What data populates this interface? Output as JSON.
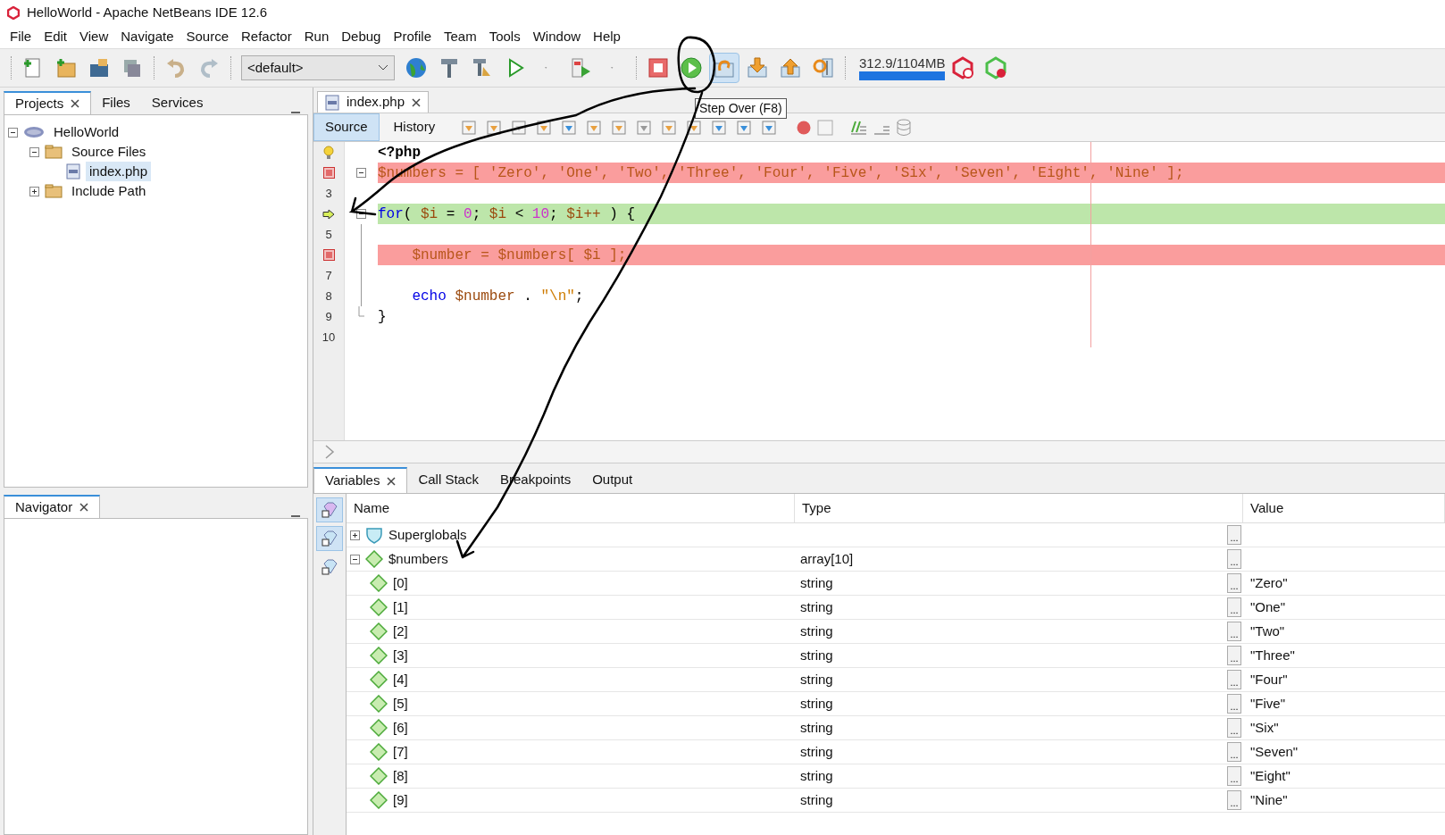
{
  "window": {
    "title": "HelloWorld - Apache NetBeans IDE 12.6"
  },
  "menu": [
    "File",
    "Edit",
    "View",
    "Navigate",
    "Source",
    "Refactor",
    "Run",
    "Debug",
    "Profile",
    "Team",
    "Tools",
    "Window",
    "Help"
  ],
  "toolbar": {
    "config": "<default>",
    "memory": "312.9/1104MB",
    "tooltip": "Step Over (F8)"
  },
  "left_tabs": [
    {
      "label": "Projects",
      "selected": true
    },
    {
      "label": "Files",
      "selected": false
    },
    {
      "label": "Services",
      "selected": false
    }
  ],
  "project_tree": [
    {
      "label": "HelloWorld",
      "kind": "project",
      "expanded": true,
      "selected": false,
      "children": [
        {
          "label": "Source Files",
          "kind": "folder",
          "expanded": true,
          "selected": false,
          "children": [
            {
              "label": "index.php",
              "kind": "file",
              "selected": true
            }
          ]
        },
        {
          "label": "Include Path",
          "kind": "folder",
          "expanded": false,
          "selected": false
        }
      ]
    }
  ],
  "navigator": {
    "title": "Navigator"
  },
  "editor_tabs": [
    {
      "label": "index.php",
      "selected": true
    }
  ],
  "view_tabs": [
    {
      "label": "Source",
      "selected": true
    },
    {
      "label": "History",
      "selected": false
    }
  ],
  "code_lines": [
    {
      "kind": "hint",
      "fold_start": false,
      "in_fold": false,
      "fold_end": false,
      "tokens": [
        {
          "text": "<?php",
          "kind": "tag"
        }
      ]
    },
    {
      "kind": "breakpoint",
      "fold_start": true,
      "in_fold": false,
      "fold_end": false,
      "tokens": [
        {
          "text": "$numbers = [ 'Zero', 'One', 'Two', 'Three', 'Four', 'Five', 'Six', 'Seven', 'Eight', 'Nine' ];",
          "kind": "plain"
        }
      ]
    },
    {
      "kind": "line",
      "number": "3",
      "fold_start": false,
      "in_fold": false,
      "fold_end": false
    },
    {
      "kind": "current",
      "fold_start": true,
      "in_fold": false,
      "fold_end": false,
      "tokens": [
        {
          "text": "for",
          "kind": "keyword"
        },
        {
          "text": "( ",
          "kind": "plain"
        },
        {
          "text": "$i",
          "kind": "var"
        },
        {
          "text": " = ",
          "kind": "plain"
        },
        {
          "text": "0",
          "kind": "number"
        },
        {
          "text": "; ",
          "kind": "plain"
        },
        {
          "text": "$i",
          "kind": "var"
        },
        {
          "text": " < ",
          "kind": "plain"
        },
        {
          "text": "10",
          "kind": "number"
        },
        {
          "text": "; ",
          "kind": "plain"
        },
        {
          "text": "$i++",
          "kind": "var"
        },
        {
          "text": " ) {",
          "kind": "plain"
        }
      ]
    },
    {
      "kind": "line",
      "number": "5",
      "fold_start": false,
      "in_fold": true,
      "fold_end": false
    },
    {
      "kind": "breakpoint",
      "fold_start": false,
      "in_fold": true,
      "fold_end": false,
      "tokens": [
        {
          "text": "    $number = $numbers[ $i ];",
          "kind": "plain"
        }
      ]
    },
    {
      "kind": "line",
      "number": "7",
      "fold_start": false,
      "in_fold": true,
      "fold_end": false
    },
    {
      "kind": "line",
      "number": "8",
      "fold_start": false,
      "in_fold": true,
      "fold_end": false,
      "tokens": [
        {
          "text": "    echo ",
          "kind": "keyword"
        },
        {
          "text": "$number",
          "kind": "var"
        },
        {
          "text": " . ",
          "kind": "plain"
        },
        {
          "text": "\"\\n\"",
          "kind": "string"
        },
        {
          "text": ";",
          "kind": "plain"
        }
      ]
    },
    {
      "kind": "line",
      "number": "9",
      "fold_start": false,
      "in_fold": false,
      "fold_end": true,
      "tokens": [
        {
          "text": "}",
          "kind": "plain"
        }
      ]
    },
    {
      "kind": "line",
      "number": "10",
      "fold_start": false,
      "in_fold": false,
      "fold_end": false
    }
  ],
  "debugger_tabs": [
    {
      "label": "Variables",
      "selected": true
    },
    {
      "label": "Call Stack",
      "selected": false
    },
    {
      "label": "Breakpoints",
      "selected": false
    },
    {
      "label": "Output",
      "selected": false
    }
  ],
  "variable_tools": [
    {
      "on": true
    },
    {
      "on": true
    },
    {
      "on": false
    }
  ],
  "variables": {
    "columns": [
      "Name",
      "Type",
      "Value"
    ],
    "rows": [
      {
        "name": "Superglobals",
        "kind": "group",
        "expanded": false,
        "button": "..."
      },
      {
        "name": "$numbers",
        "kind": "var",
        "expanded": true,
        "type": "array[10]",
        "button": "...",
        "children": [
          {
            "name": "[0]",
            "type": "string",
            "value": "\"Zero\"",
            "button": "..."
          },
          {
            "name": "[1]",
            "type": "string",
            "value": "\"One\"",
            "button": "..."
          },
          {
            "name": "[2]",
            "type": "string",
            "value": "\"Two\"",
            "button": "..."
          },
          {
            "name": "[3]",
            "type": "string",
            "value": "\"Three\"",
            "button": "..."
          },
          {
            "name": "[4]",
            "type": "string",
            "value": "\"Four\"",
            "button": "..."
          },
          {
            "name": "[5]",
            "type": "string",
            "value": "\"Five\"",
            "button": "..."
          },
          {
            "name": "[6]",
            "type": "string",
            "value": "\"Six\"",
            "button": "..."
          },
          {
            "name": "[7]",
            "type": "string",
            "value": "\"Seven\"",
            "button": "..."
          },
          {
            "name": "[8]",
            "type": "string",
            "value": "\"Eight\"",
            "button": "..."
          },
          {
            "name": "[9]",
            "type": "string",
            "value": "\"Nine\"",
            "button": "..."
          }
        ]
      }
    ]
  }
}
